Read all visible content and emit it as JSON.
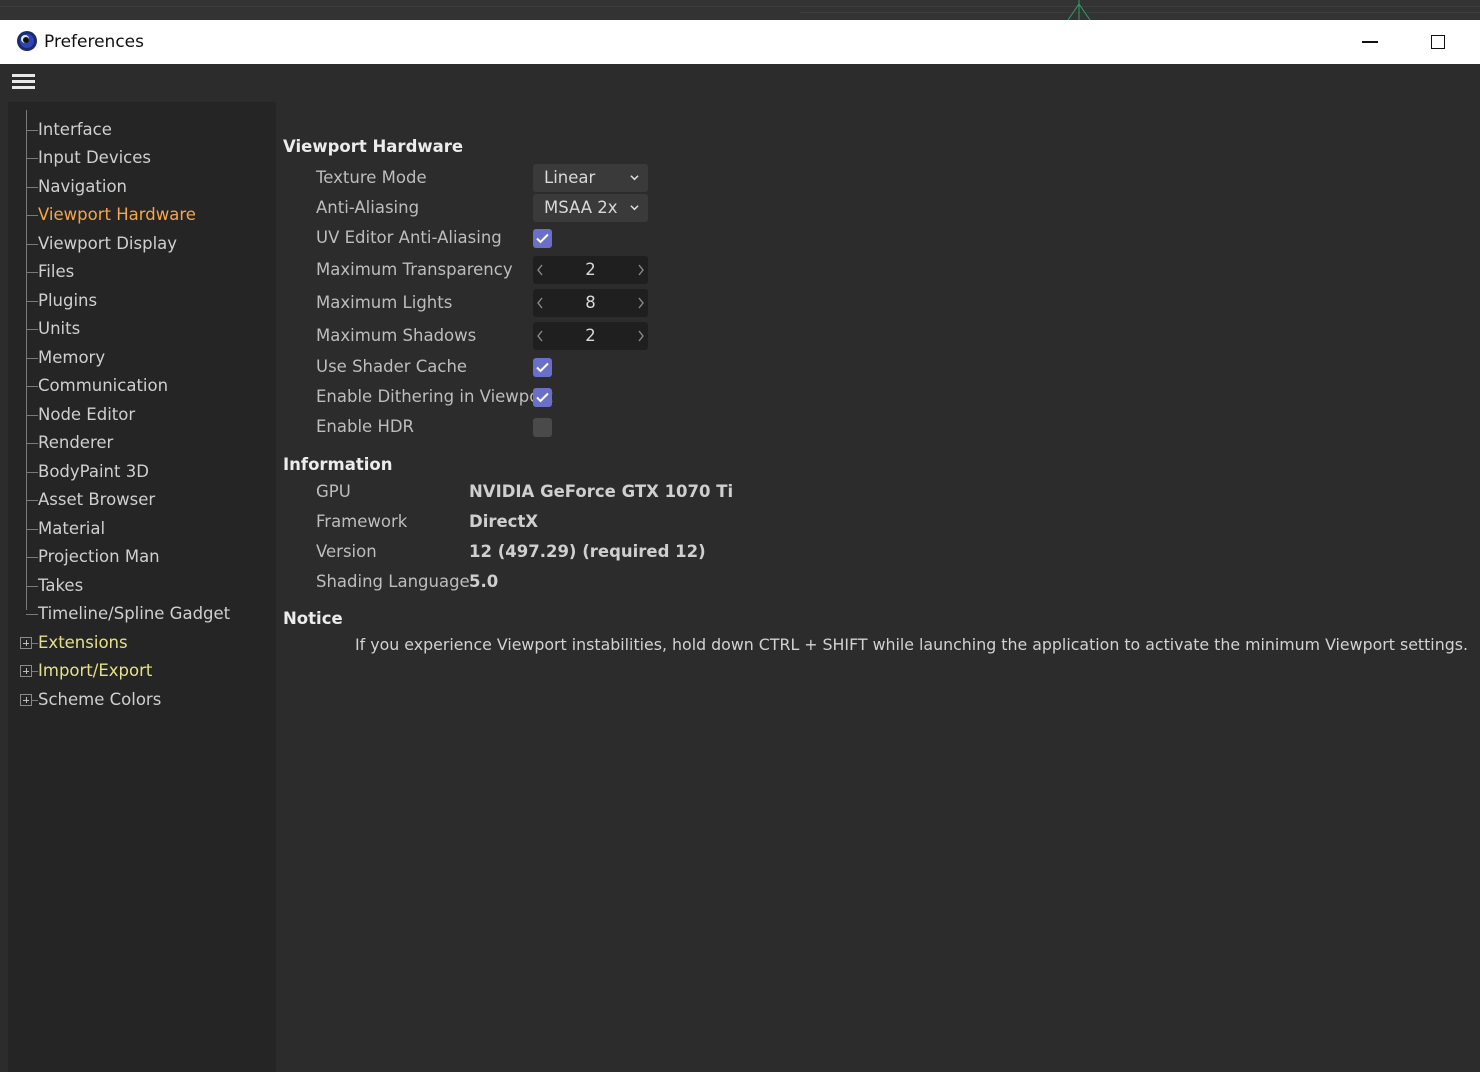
{
  "window": {
    "title": "Preferences"
  },
  "sidebar": {
    "items": [
      {
        "label": "Interface",
        "state": "normal"
      },
      {
        "label": "Input Devices",
        "state": "normal"
      },
      {
        "label": "Navigation",
        "state": "normal"
      },
      {
        "label": "Viewport Hardware",
        "state": "active"
      },
      {
        "label": "Viewport Display",
        "state": "normal"
      },
      {
        "label": "Files",
        "state": "normal"
      },
      {
        "label": "Plugins",
        "state": "normal"
      },
      {
        "label": "Units",
        "state": "normal"
      },
      {
        "label": "Memory",
        "state": "normal"
      },
      {
        "label": "Communication",
        "state": "normal"
      },
      {
        "label": "Node Editor",
        "state": "normal"
      },
      {
        "label": "Renderer",
        "state": "normal"
      },
      {
        "label": "BodyPaint 3D",
        "state": "normal"
      },
      {
        "label": "Asset Browser",
        "state": "normal"
      },
      {
        "label": "Material",
        "state": "normal"
      },
      {
        "label": "Projection Man",
        "state": "normal"
      },
      {
        "label": "Takes",
        "state": "normal"
      },
      {
        "label": "Timeline/Spline Gadget",
        "state": "normal"
      },
      {
        "label": "Extensions",
        "state": "group"
      },
      {
        "label": "Import/Export",
        "state": "group"
      },
      {
        "label": "Scheme Colors",
        "state": "group-plain"
      }
    ]
  },
  "viewport_hardware": {
    "title": "Viewport Hardware",
    "texture_mode": {
      "label": "Texture Mode",
      "value": "Linear"
    },
    "anti_aliasing": {
      "label": "Anti-Aliasing",
      "value": "MSAA 2x"
    },
    "uv_editor_aa": {
      "label": "UV Editor Anti-Aliasing",
      "checked": true
    },
    "max_transparency": {
      "label": "Maximum Transparency",
      "value": "2"
    },
    "max_lights": {
      "label": "Maximum Lights",
      "value": "8"
    },
    "max_shadows": {
      "label": "Maximum Shadows",
      "value": "2"
    },
    "use_shader_cache": {
      "label": "Use Shader Cache",
      "checked": true
    },
    "enable_dithering": {
      "label": "Enable Dithering in Viewport",
      "checked": true
    },
    "enable_hdr": {
      "label": "Enable HDR",
      "checked": false
    }
  },
  "information": {
    "title": "Information",
    "rows": [
      {
        "label": "GPU",
        "value": "NVIDIA GeForce GTX 1070 Ti"
      },
      {
        "label": "Framework",
        "value": "DirectX"
      },
      {
        "label": "Version",
        "value": "12 (497.29) (required 12)"
      },
      {
        "label": "Shading Language",
        "value": "5.0"
      }
    ]
  },
  "notice": {
    "title": "Notice",
    "text": "If you experience Viewport instabilities, hold down CTRL + SHIFT while launching the application to activate the minimum Viewport settings."
  },
  "colors": {
    "active_item": "#f6a64a",
    "group_item": "#e4e18a",
    "checkbox_on": "#6a6fc7"
  }
}
